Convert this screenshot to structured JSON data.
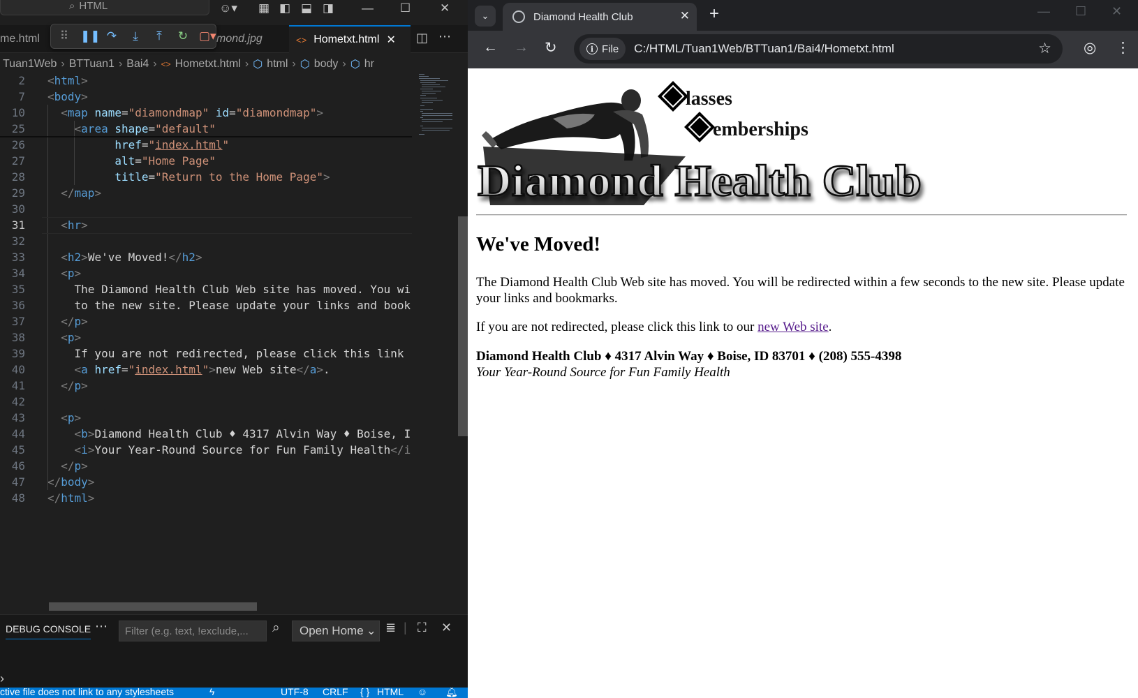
{
  "vscode": {
    "search_label": "HTML",
    "tabs": [
      {
        "label": "me.html"
      },
      {
        "label": "mond.jpg"
      },
      {
        "label": "Hometxt.html"
      }
    ],
    "breadcrumb": [
      "Tuan1Web",
      "BTTuan1",
      "Bai4",
      "Hometxt.html",
      "html",
      "body",
      "hr"
    ],
    "code_lines": [
      {
        "n": "2",
        "html": "<span class=\"t-brk\">&lt;</span><span class=\"t-tag\">html</span><span class=\"t-brk\">&gt;</span>"
      },
      {
        "n": "7",
        "html": "<span class=\"t-brk\">&lt;</span><span class=\"t-tag\">body</span><span class=\"t-brk\">&gt;</span>"
      },
      {
        "n": "10",
        "html": "  <span class=\"t-brk\">&lt;</span><span class=\"t-tag\">map</span> <span class=\"t-attr\">name</span><span class=\"t-txt\">=</span><span class=\"t-str\">\"diamondmap\"</span> <span class=\"t-attr\">id</span><span class=\"t-txt\">=</span><span class=\"t-str\">\"diamondmap\"</span><span class=\"t-brk\">&gt;</span>"
      },
      {
        "n": "25",
        "html": "    <span class=\"t-brk\">&lt;</span><span class=\"t-tag\">area</span> <span class=\"t-attr\">shape</span><span class=\"t-txt\">=</span><span class=\"t-str\">\"default\"</span>"
      },
      {
        "n": "26",
        "html": "          <span class=\"t-attr\">href</span><span class=\"t-txt\">=</span><span class=\"t-str\">\"</span><span class=\"t-link\">index.html</span><span class=\"t-str\">\"</span>"
      },
      {
        "n": "27",
        "html": "          <span class=\"t-attr\">alt</span><span class=\"t-txt\">=</span><span class=\"t-str\">\"Home Page\"</span>"
      },
      {
        "n": "28",
        "html": "          <span class=\"t-attr\">title</span><span class=\"t-txt\">=</span><span class=\"t-str\">\"Return to the Home Page\"</span><span class=\"t-brk\">&gt;</span>"
      },
      {
        "n": "29",
        "html": "  <span class=\"t-brk\">&lt;/</span><span class=\"t-tag\">map</span><span class=\"t-brk\">&gt;</span>"
      },
      {
        "n": "30",
        "html": ""
      },
      {
        "n": "31",
        "html": "  <span class=\"t-brk\">&lt;</span><span class=\"t-tag\">hr</span><span class=\"t-brk\">&gt;</span>"
      },
      {
        "n": "32",
        "html": ""
      },
      {
        "n": "33",
        "html": "  <span class=\"t-brk\">&lt;</span><span class=\"t-tag\">h2</span><span class=\"t-brk\">&gt;</span><span class=\"t-txt\">We've Moved!</span><span class=\"t-brk\">&lt;/</span><span class=\"t-tag\">h2</span><span class=\"t-brk\">&gt;</span>"
      },
      {
        "n": "34",
        "html": "  <span class=\"t-brk\">&lt;</span><span class=\"t-tag\">p</span><span class=\"t-brk\">&gt;</span>"
      },
      {
        "n": "35",
        "html": "    <span class=\"t-txt\">The Diamond Health Club Web site has moved. You wi</span>"
      },
      {
        "n": "36",
        "html": "    <span class=\"t-txt\">to the new site. Please update your links and book</span>"
      },
      {
        "n": "37",
        "html": "  <span class=\"t-brk\">&lt;/</span><span class=\"t-tag\">p</span><span class=\"t-brk\">&gt;</span>"
      },
      {
        "n": "38",
        "html": "  <span class=\"t-brk\">&lt;</span><span class=\"t-tag\">p</span><span class=\"t-brk\">&gt;</span>"
      },
      {
        "n": "39",
        "html": "    <span class=\"t-txt\">If you are not redirected, please click this link </span>"
      },
      {
        "n": "40",
        "html": "    <span class=\"t-brk\">&lt;</span><span class=\"t-tag\">a</span> <span class=\"t-attr\">href</span><span class=\"t-txt\">=</span><span class=\"t-str\">\"</span><span class=\"t-link\">index.html</span><span class=\"t-str\">\"</span><span class=\"t-brk\">&gt;</span><span class=\"t-txt\">new Web site</span><span class=\"t-brk\">&lt;/</span><span class=\"t-tag\">a</span><span class=\"t-brk\">&gt;</span><span class=\"t-txt\">.</span>"
      },
      {
        "n": "41",
        "html": "  <span class=\"t-brk\">&lt;/</span><span class=\"t-tag\">p</span><span class=\"t-brk\">&gt;</span>"
      },
      {
        "n": "42",
        "html": ""
      },
      {
        "n": "43",
        "html": "  <span class=\"t-brk\">&lt;</span><span class=\"t-tag\">p</span><span class=\"t-brk\">&gt;</span>"
      },
      {
        "n": "44",
        "html": "    <span class=\"t-brk\">&lt;</span><span class=\"t-tag\">b</span><span class=\"t-brk\">&gt;</span><span class=\"t-txt\">Diamond Health Club ♦ 4317 Alvin Way ♦ Boise, I</span>"
      },
      {
        "n": "45",
        "html": "    <span class=\"t-brk\">&lt;</span><span class=\"t-tag\">i</span><span class=\"t-brk\">&gt;</span><span class=\"t-txt\">Your Year-Round Source for Fun Family Health</span><span class=\"t-brk\">&lt;/i</span>"
      },
      {
        "n": "46",
        "html": "  <span class=\"t-brk\">&lt;/</span><span class=\"t-tag\">p</span><span class=\"t-brk\">&gt;</span>"
      },
      {
        "n": "47",
        "html": "<span class=\"t-brk\">&lt;/</span><span class=\"t-tag\">body</span><span class=\"t-brk\">&gt;</span>"
      },
      {
        "n": "48",
        "html": "<span class=\"t-brk\">&lt;/</span><span class=\"t-tag\">html</span><span class=\"t-brk\">&gt;</span>"
      }
    ],
    "current_line": "31",
    "panel": {
      "tab_label": "DEBUG CONSOLE",
      "filter_placeholder": "Filter (e.g. text, !exclude,...",
      "launch_config": "Open Home"
    },
    "status": {
      "message": "ctive file does not link to any stylesheets",
      "encoding": "UTF-8",
      "eol": "CRLF",
      "language": "HTML"
    }
  },
  "browser": {
    "tab_title": "Diamond Health Club",
    "url_chip": "File",
    "url": "C:/HTML/Tuan1Web/BTTuan1/Bai4/Hometxt.html",
    "page": {
      "banner": {
        "line1": "lasses",
        "line2": "emberships",
        "big": "Diamond Health Club"
      },
      "heading": "We've Moved!",
      "para1": "The Diamond Health Club Web site has moved. You will be redirected within a few seconds to the new site. Please update your links and bookmarks.",
      "para2_prefix": "If you are not redirected, please click this link to our ",
      "para2_link": "new Web site",
      "para2_suffix": ".",
      "address": "Diamond Health Club ♦ 4317 Alvin Way ♦ Boise, ID 83701 ♦ (208) 555-4398",
      "tagline": "Your Year-Round Source for Fun Family Health"
    }
  },
  "colors": {
    "vscode_bg": "#1f1f1f",
    "accent": "#0078d4",
    "link_visited": "#551a8b"
  }
}
